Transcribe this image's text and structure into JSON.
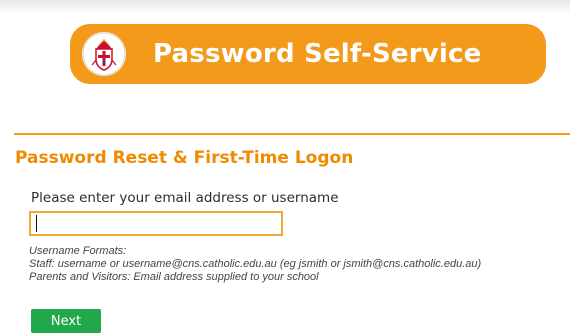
{
  "header": {
    "title": "Password Self-Service",
    "logo_icon": "diocese-crest-icon",
    "banner_color": "#f39a1a"
  },
  "page": {
    "heading": "Password Reset & First-Time Logon",
    "heading_color": "#f08a00"
  },
  "form": {
    "prompt": "Please enter your email address or username",
    "input_value": "",
    "input_border_color": "#f3a63a",
    "notes": {
      "title": "Username Formats:",
      "staff": "Staff: username or username@cns.catholic.edu.au (eg jsmith or jsmith@cns.catholic.edu.au)",
      "parents": "Parents and Visitors: Email address supplied to your school"
    },
    "next_label": "Next",
    "next_color": "#21a84a"
  }
}
